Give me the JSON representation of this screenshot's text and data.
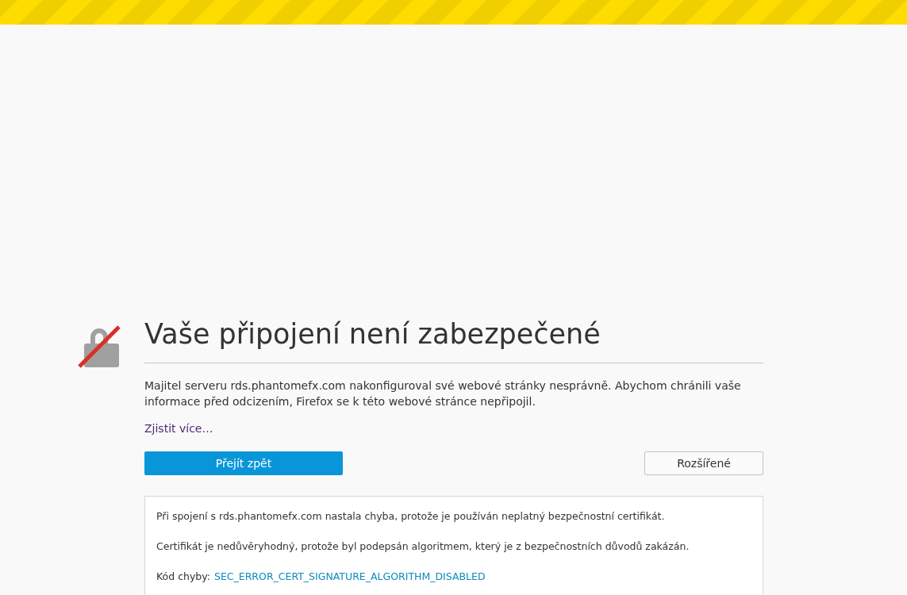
{
  "title": "Vaše připojení není zabezpečené",
  "description": "Majitel serveru rds.phantomefx.com nakonfiguroval své webové stránky nesprávně. Abychom chránili vaše informace před odcizením, Firefox se k této webové stránce nepřipojil.",
  "learn_more": "Zjistit více…",
  "buttons": [
    {
      "label": "Přejít zpět",
      "kind": "primary"
    },
    {
      "label": "Rozšířené",
      "kind": "secondary"
    }
  ],
  "details": {
    "paragraphs": [
      "Při spojení s rds.phantomefx.com nastala chyba, protože je používán neplatný bezpečnostní certifikát.",
      "Certifikát je nedůvěryhodný, protože byl podepsán algoritmem, který je z bezpečnostních důvodů zakázán."
    ],
    "error_label": "Kód chyby:",
    "error_code": "SEC_ERROR_CERT_SIGNATURE_ALGORITHM_DISABLED"
  }
}
